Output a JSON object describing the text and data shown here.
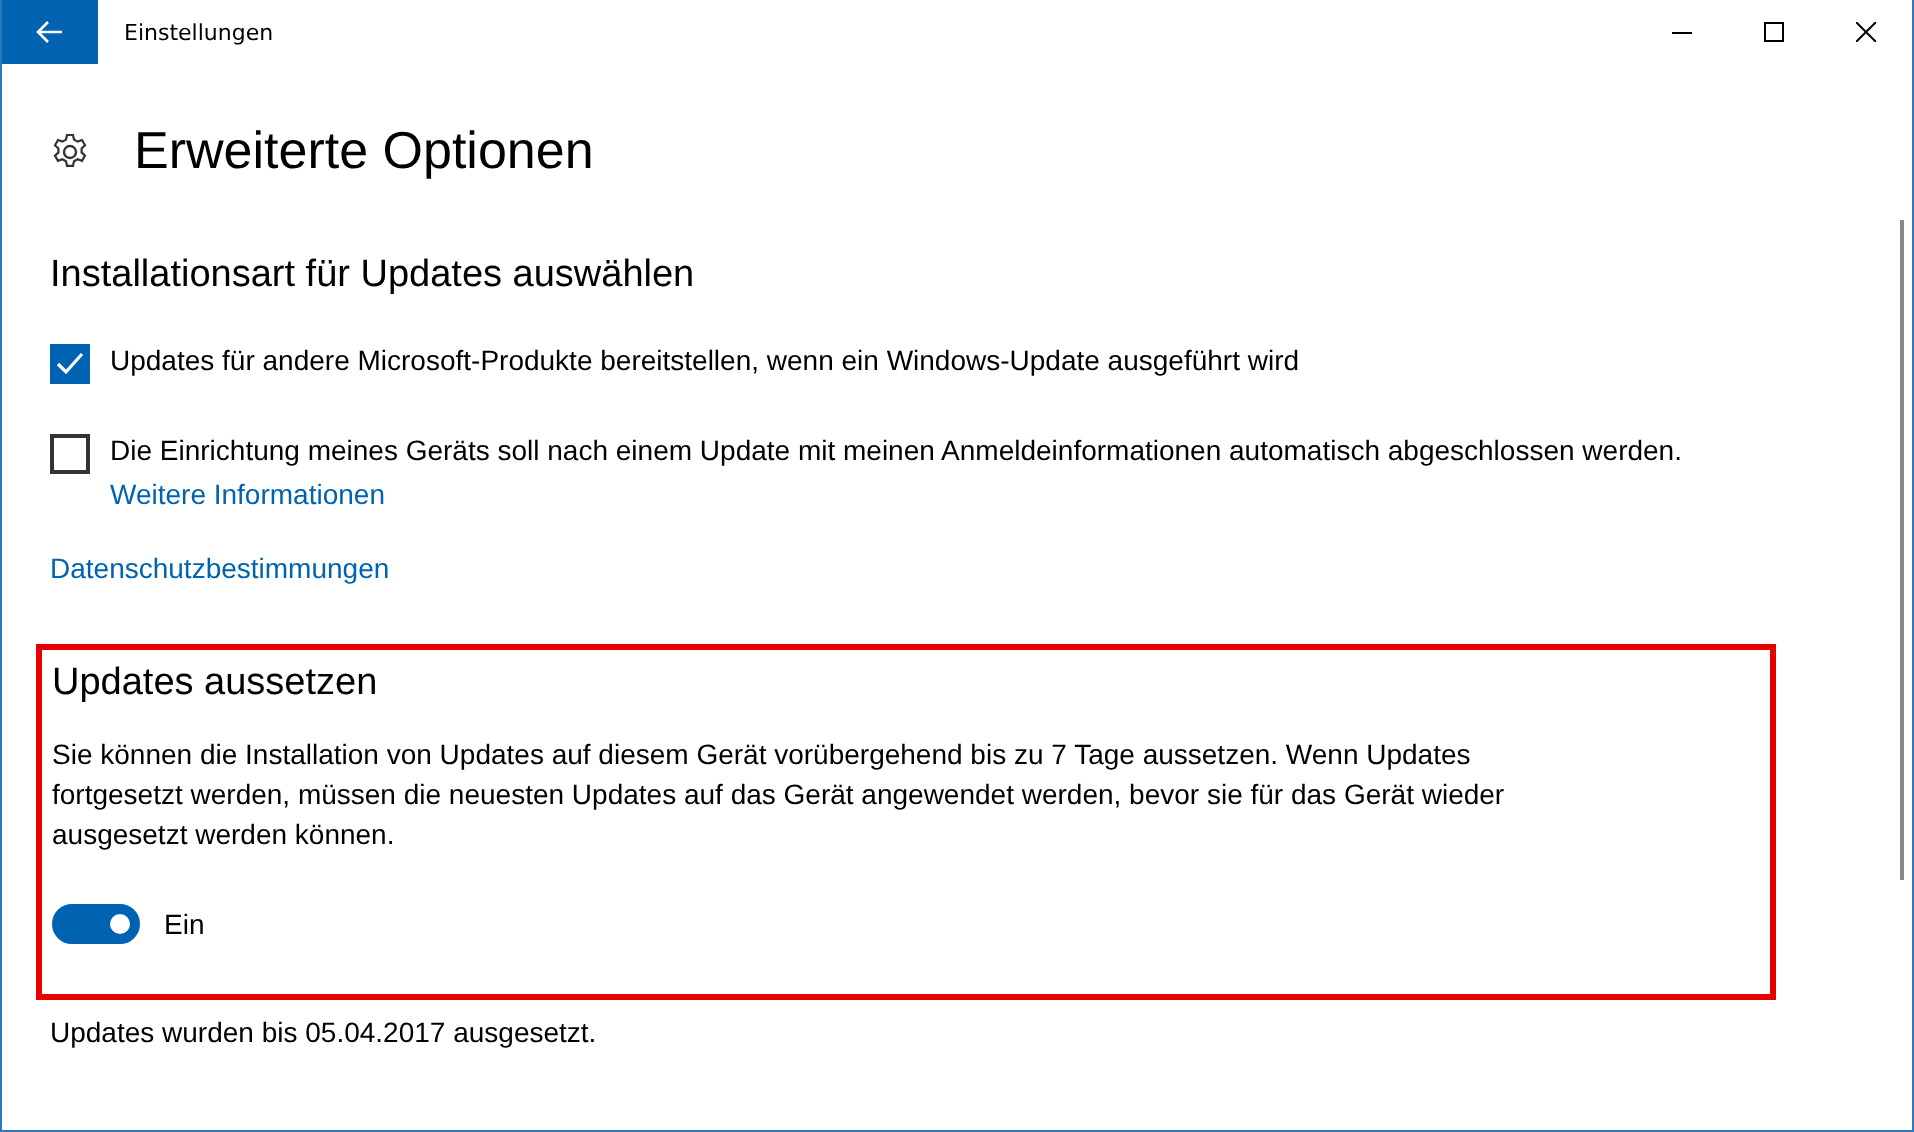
{
  "window": {
    "title": "Einstellungen"
  },
  "page_title": "Erweiterte Optionen",
  "section": {
    "heading": "Installationsart für Updates auswählen",
    "options": [
      {
        "label": "Updates für andere Microsoft-Produkte bereitstellen, wenn ein Windows-Update ausgeführt wird",
        "checked": true
      },
      {
        "label": "Die Einrichtung meines Geräts soll nach einem Update mit meinen Anmeldeinformationen automatisch abgeschlossen werden.",
        "checked": false,
        "link": "Weitere Informationen"
      }
    ],
    "privacy_link": "Datenschutzbestimmungen"
  },
  "pause": {
    "heading": "Updates aussetzen",
    "description": "Sie können die Installation von Updates auf diesem Gerät vorübergehend bis zu 7 Tage aussetzen. Wenn Updates fortgesetzt werden, müssen die neuesten Updates auf das Gerät angewendet werden, bevor sie für das Gerät wieder ausgesetzt werden können.",
    "toggle": {
      "on": true,
      "label": "Ein"
    }
  },
  "status": "Updates wurden bis 05.04.2017 ausgesetzt."
}
